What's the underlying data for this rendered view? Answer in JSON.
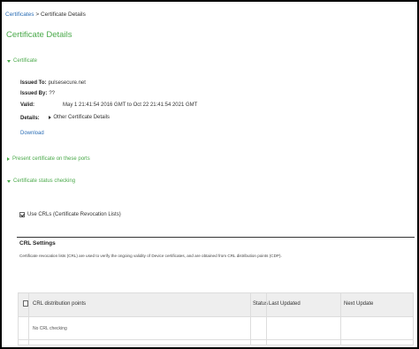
{
  "breadcrumb": {
    "parent": "Certificates",
    "separator": " > ",
    "current": "Certificate Details"
  },
  "page_title": "Certificate Details",
  "certificate_section": {
    "header": "Certificate",
    "issued_to_label": "Issued To:",
    "issued_to_value": "pulsesecure.net",
    "issued_by_label": "Issued By:",
    "issued_by_value": "??",
    "valid_label": "Valid:",
    "valid_value": "May 1 21:41:54 2016 GMT to Oct 22 21:41:54 2021 GMT",
    "details_label": "Details:",
    "details_link": "Other Certificate Details",
    "download_link": "Download"
  },
  "ports_section": {
    "header": "Present certificate on these ports"
  },
  "status_section": {
    "header": "Certificate status checking",
    "use_crls_label": "Use CRLs (Certificate Revocation Lists)",
    "use_crls_checked": true
  },
  "crl_settings": {
    "title": "CRL Settings",
    "description": "Certificate revocation lists (CRL) are used to verify the ongoing validity of Device certificates, and are obtained from CRL distribution points (CDP).",
    "columns": [
      "CRL distribution points",
      "Status",
      "Last Updated",
      "Next Update"
    ],
    "rows": [
      [
        "No CRL checking",
        "",
        "",
        ""
      ]
    ]
  }
}
